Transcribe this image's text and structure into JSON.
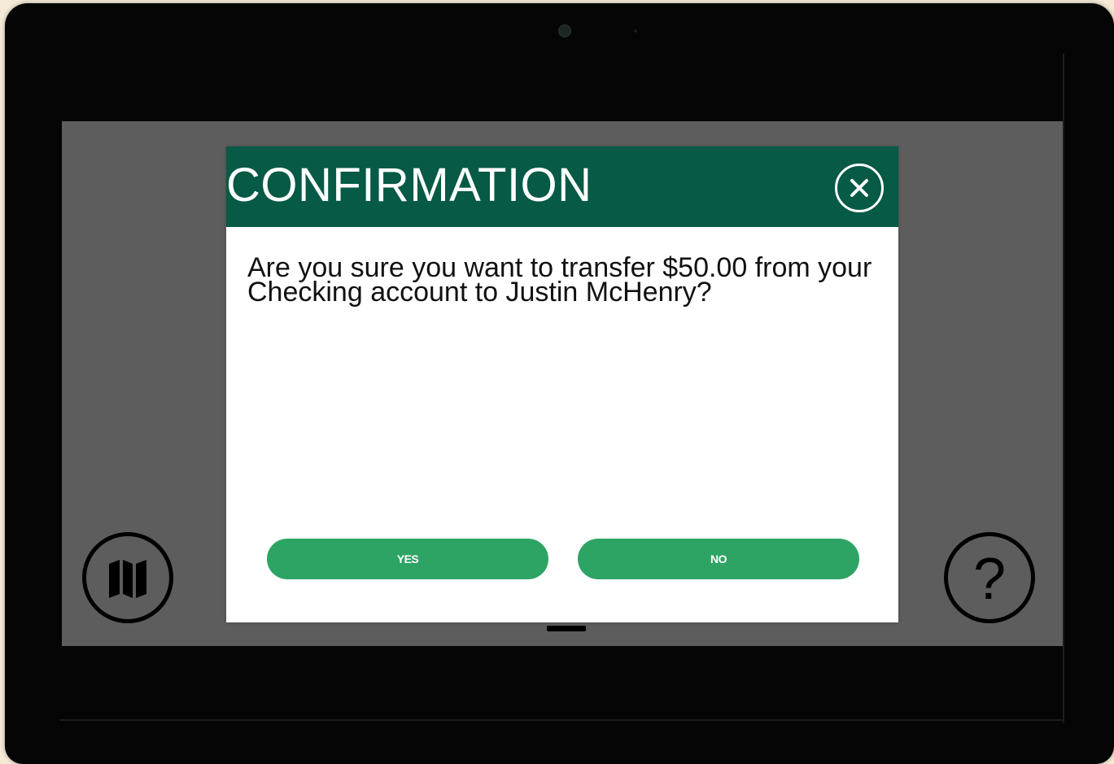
{
  "dialog": {
    "title": "CONFIRMATION",
    "message": "Are you sure you want to transfer $50.00 from your Checking account to Justin McHenry?",
    "yes_label": "YES",
    "no_label": "NO",
    "close_icon": "close-circle-icon"
  },
  "screen_controls": {
    "map_icon": "map-icon",
    "help_icon": "help-icon",
    "help_glyph": "?"
  },
  "colors": {
    "header": "#075a45",
    "button": "#2ea464",
    "overlay": "#5d5d5d"
  }
}
